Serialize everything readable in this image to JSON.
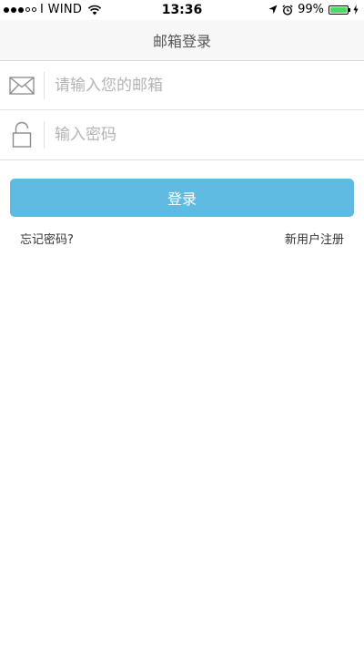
{
  "status_bar": {
    "carrier": "I WIND",
    "time": "13:36",
    "battery_percent": "99%",
    "battery_level": 0.99,
    "battery_color": "#4cd964"
  },
  "nav": {
    "title": "邮箱登录"
  },
  "form": {
    "email_placeholder": "请输入您的邮箱",
    "email_value": "",
    "email_icon": "envelope-icon",
    "password_placeholder": "输入密码",
    "password_value": "",
    "password_icon": "unlock-icon"
  },
  "actions": {
    "login_label": "登录",
    "login_color": "#5fbbe2",
    "forgot_password_label": "忘记密码?",
    "register_label": "新用户注册"
  }
}
